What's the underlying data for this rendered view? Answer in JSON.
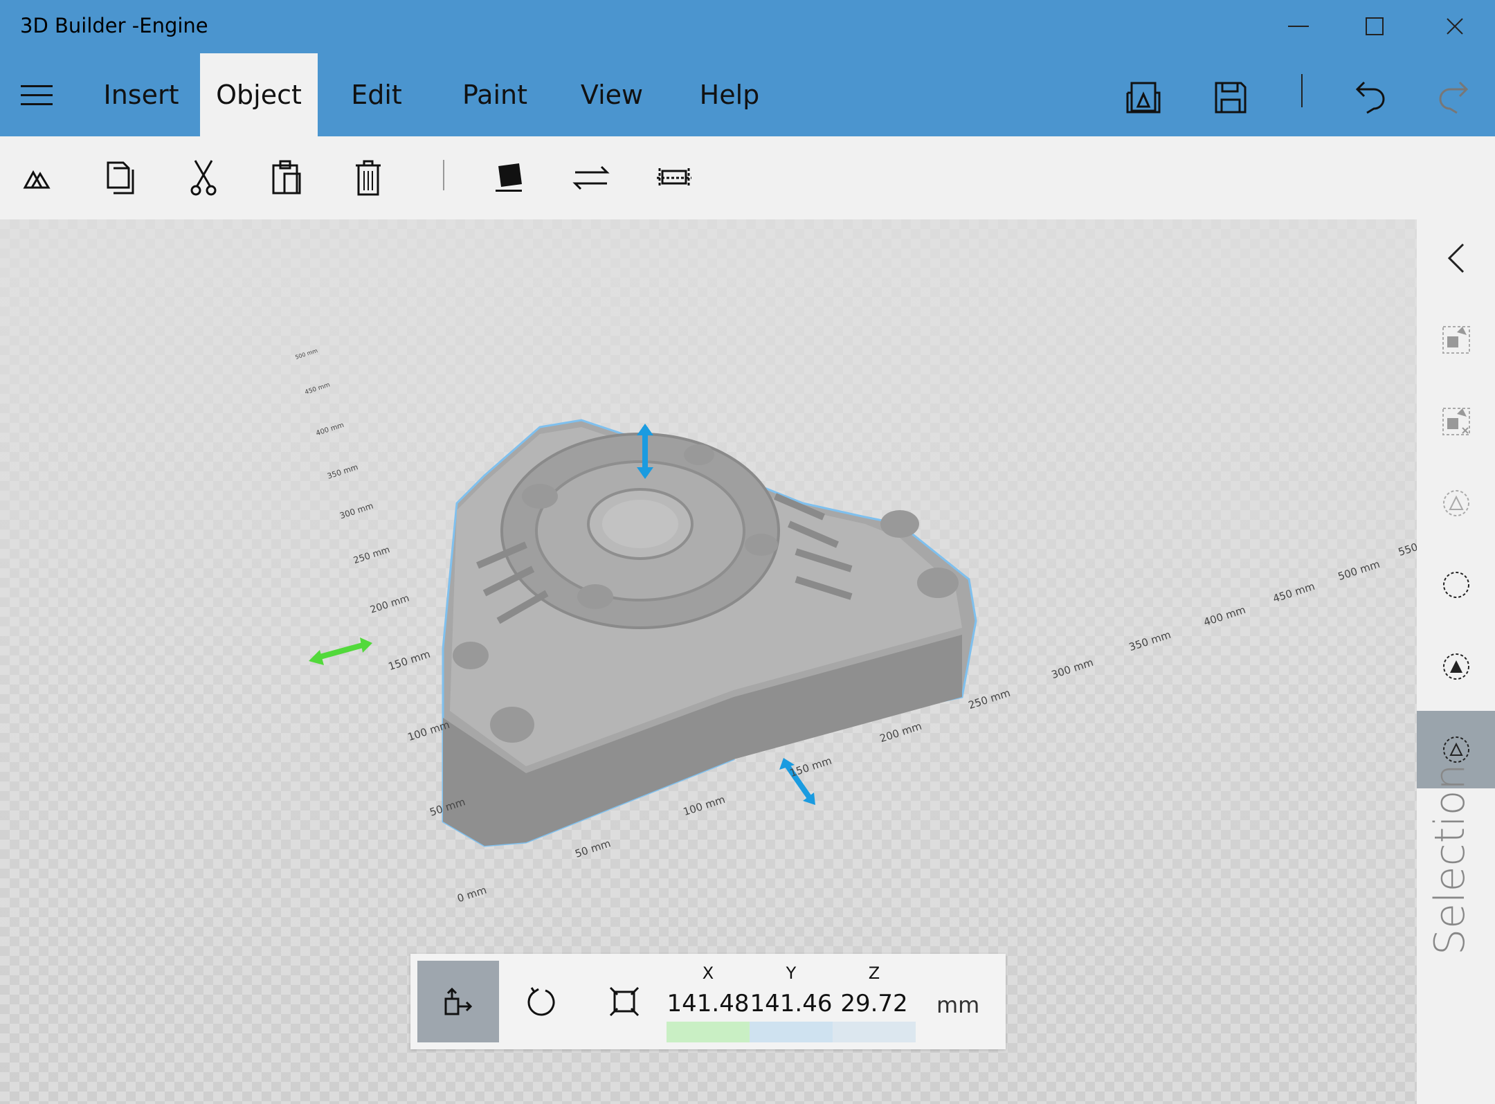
{
  "app": {
    "title": "3D Builder -Engine"
  },
  "menu": {
    "tabs": [
      "Insert",
      "Object",
      "Edit",
      "Paint",
      "View",
      "Help"
    ],
    "active_tab": "Object"
  },
  "axis": {
    "x_labels": [
      "0 mm",
      "50 mm",
      "100 mm",
      "150 mm",
      "200 mm",
      "250 mm",
      "300 mm",
      "350 mm",
      "400 mm",
      "450 mm",
      "500 mm",
      "550"
    ],
    "y_labels": [
      "50 mm",
      "100 mm",
      "150 mm",
      "200 mm",
      "250 mm",
      "300 mm",
      "350 mm",
      "400 mm",
      "450 mm",
      "500 mm"
    ]
  },
  "transform": {
    "x_label": "X",
    "y_label": "Y",
    "z_label": "Z",
    "x": "141.48",
    "y": "141.46",
    "z": "29.72",
    "unit": "mm"
  },
  "sidebar": {
    "panel_label": "Selection"
  },
  "colors": {
    "accent": "#4b95cf",
    "selection_outline": "#5aaee8",
    "gizmo_blue": "#1a9be0",
    "gizmo_green": "#52d93b",
    "x_bar": "#c9efc4",
    "y_bar": "#cfe2f0"
  }
}
